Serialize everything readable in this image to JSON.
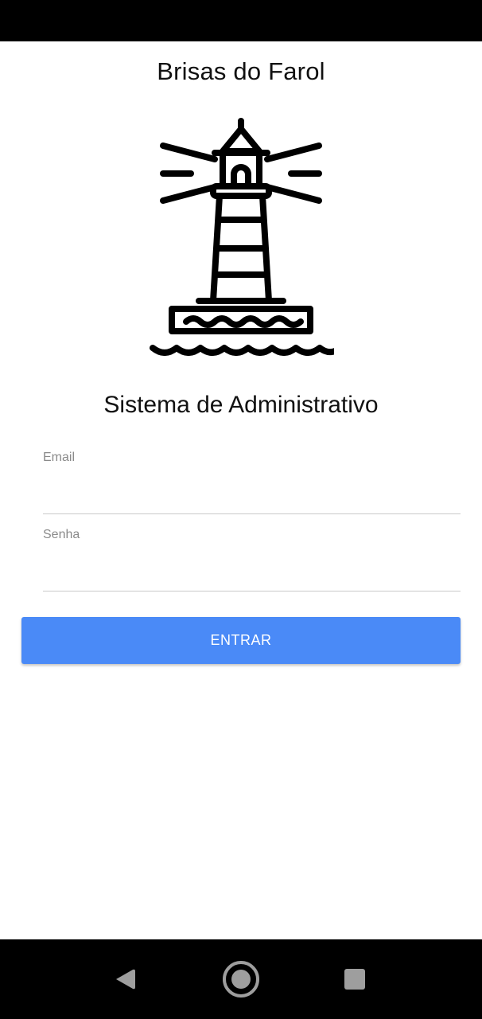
{
  "app": {
    "title": "Brisas do Farol",
    "subtitle": "Sistema de Administrativo"
  },
  "logo": {
    "icon": "lighthouse-icon"
  },
  "form": {
    "email": {
      "label": "Email",
      "value": ""
    },
    "password": {
      "label": "Senha",
      "value": ""
    },
    "submit_label": "ENTRAR"
  },
  "nav": {
    "back_icon": "back-icon",
    "home_icon": "home-icon",
    "recents_icon": "recents-icon"
  },
  "colors": {
    "accent": "#4a8af7",
    "bars": "#000000",
    "text": "#111111",
    "label": "#8a8a8a"
  }
}
